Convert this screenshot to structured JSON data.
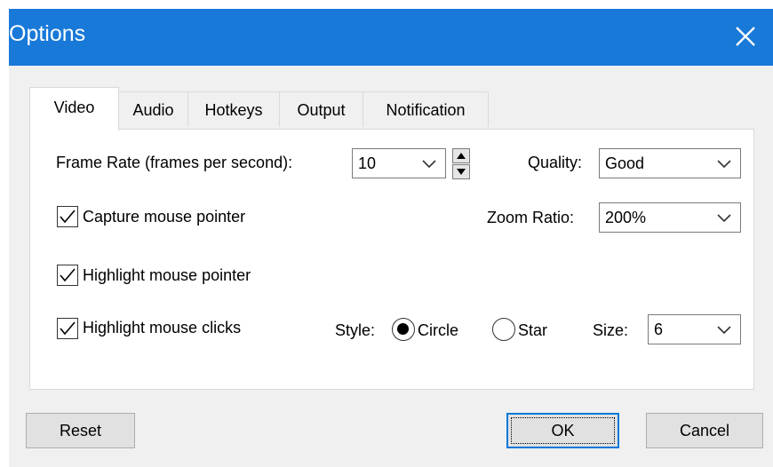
{
  "window": {
    "title": "Options",
    "close_icon": "close-icon"
  },
  "tabs": [
    {
      "label": "Video",
      "active": true
    },
    {
      "label": "Audio",
      "active": false
    },
    {
      "label": "Hotkeys",
      "active": false
    },
    {
      "label": "Output",
      "active": false
    },
    {
      "label": "Notification",
      "active": false
    }
  ],
  "video": {
    "frame_rate": {
      "label": "Frame Rate (frames per second):",
      "value": "10"
    },
    "quality": {
      "label": "Quality:",
      "value": "Good"
    },
    "capture_pointer": {
      "label": "Capture mouse pointer",
      "checked": true
    },
    "zoom_ratio": {
      "label": "Zoom Ratio:",
      "value": "200%"
    },
    "highlight_pointer": {
      "label": "Highlight mouse pointer",
      "checked": true
    },
    "highlight_clicks": {
      "label": "Highlight mouse clicks",
      "checked": true
    },
    "style": {
      "label": "Style:",
      "options": [
        {
          "label": "Circle",
          "selected": true
        },
        {
          "label": "Star",
          "selected": false
        }
      ]
    },
    "size": {
      "label": "Size:",
      "value": "6"
    }
  },
  "buttons": {
    "reset": "Reset",
    "ok": "OK",
    "cancel": "Cancel"
  },
  "colors": {
    "titlebar": "#1879d8",
    "default_button_border": "#0078d7"
  }
}
